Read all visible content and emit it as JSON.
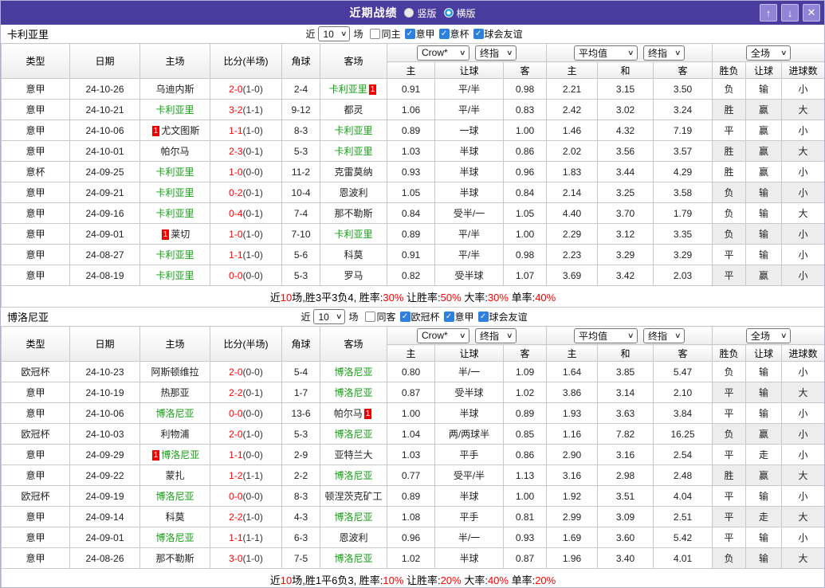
{
  "window": {
    "title": "近期战绩",
    "view_options": [
      {
        "label": "竖版",
        "selected": true
      },
      {
        "label": "横版",
        "selected": false
      }
    ]
  },
  "icons": {
    "select_arrow": "∨",
    "check": "✓",
    "up": "↑",
    "down": "↓",
    "close": "✕"
  },
  "card_label": "1",
  "columns": [
    "类型",
    "日期",
    "主场",
    "比分(半场)",
    "角球",
    "客场"
  ],
  "sub_columns": [
    "主",
    "让球",
    "客",
    "主",
    "和",
    "客",
    "胜负",
    "让球",
    "进球数"
  ],
  "selects": {
    "crow": "Crow*",
    "final": "终指",
    "avg": "平均值",
    "scope": "全场"
  },
  "sections": [
    {
      "team": "卡利亚里",
      "filter": {
        "prefix": "近",
        "count": "10",
        "suffix": "场",
        "options": [
          {
            "label": "同主",
            "checked": false
          },
          {
            "label": "意甲",
            "checked": true
          },
          {
            "label": "意杯",
            "checked": true
          },
          {
            "label": "球会友谊",
            "checked": true
          }
        ]
      },
      "rows": [
        {
          "type": "意甲",
          "tc": "sa",
          "date": "24-10-26",
          "home": "乌迪内斯",
          "hg": false,
          "hc": false,
          "score": "2-0",
          "half": "(1-0)",
          "corner": "2-4",
          "away": "卡利亚里",
          "ag": true,
          "ac": true,
          "o1": "0.91",
          "hd": "平/半",
          "o2": "0.98",
          "a1": "2.21",
          "a2": "3.15",
          "a3": "3.50",
          "r1": "负",
          "c1": "b",
          "r2": "输",
          "c2": "b",
          "r3": "小",
          "c3": "b"
        },
        {
          "type": "意甲",
          "tc": "sa",
          "date": "24-10-21",
          "home": "卡利亚里",
          "hg": true,
          "hc": false,
          "score": "3-2",
          "half": "(1-1)",
          "corner": "9-12",
          "away": "都灵",
          "ag": false,
          "ac": false,
          "o1": "1.06",
          "hd": "平/半",
          "o2": "0.83",
          "a1": "2.42",
          "a2": "3.02",
          "a3": "3.24",
          "r1": "胜",
          "c1": "r",
          "r2": "赢",
          "c2": "r",
          "r3": "大",
          "c3": "r"
        },
        {
          "type": "意甲",
          "tc": "sa",
          "date": "24-10-06",
          "home": "尤文图斯",
          "hg": false,
          "hc": true,
          "score": "1-1",
          "half": "(1-0)",
          "corner": "8-3",
          "away": "卡利亚里",
          "ag": true,
          "ac": false,
          "o1": "0.89",
          "hd": "一球",
          "o2": "1.00",
          "a1": "1.46",
          "a2": "4.32",
          "a3": "7.19",
          "r1": "平",
          "c1": "g",
          "r2": "赢",
          "c2": "r",
          "r3": "小",
          "c3": "b"
        },
        {
          "type": "意甲",
          "tc": "sa",
          "date": "24-10-01",
          "home": "帕尔马",
          "hg": false,
          "hc": false,
          "score": "2-3",
          "half": "(0-1)",
          "corner": "5-3",
          "away": "卡利亚里",
          "ag": true,
          "ac": false,
          "o1": "1.03",
          "hd": "半球",
          "o2": "0.86",
          "a1": "2.02",
          "a2": "3.56",
          "a3": "3.57",
          "r1": "胜",
          "c1": "r",
          "r2": "赢",
          "c2": "r",
          "r3": "大",
          "c3": "r"
        },
        {
          "type": "意杯",
          "tc": "ib",
          "date": "24-09-25",
          "home": "卡利亚里",
          "hg": true,
          "hc": false,
          "score": "1-0",
          "half": "(0-0)",
          "corner": "11-2",
          "away": "克雷莫纳",
          "ag": false,
          "ac": false,
          "o1": "0.93",
          "hd": "半球",
          "o2": "0.96",
          "a1": "1.83",
          "a2": "3.44",
          "a3": "4.29",
          "r1": "胜",
          "c1": "r",
          "r2": "赢",
          "c2": "r",
          "r3": "小",
          "c3": "b"
        },
        {
          "type": "意甲",
          "tc": "sa",
          "date": "24-09-21",
          "home": "卡利亚里",
          "hg": true,
          "hc": false,
          "score": "0-2",
          "half": "(0-1)",
          "corner": "10-4",
          "away": "恩波利",
          "ag": false,
          "ac": false,
          "o1": "1.05",
          "hd": "半球",
          "o2": "0.84",
          "a1": "2.14",
          "a2": "3.25",
          "a3": "3.58",
          "r1": "负",
          "c1": "b",
          "r2": "输",
          "c2": "b",
          "r3": "小",
          "c3": "b"
        },
        {
          "type": "意甲",
          "tc": "sa",
          "date": "24-09-16",
          "home": "卡利亚里",
          "hg": true,
          "hc": false,
          "score": "0-4",
          "half": "(0-1)",
          "corner": "7-4",
          "away": "那不勒斯",
          "ag": false,
          "ac": false,
          "o1": "0.84",
          "hd": "受半/一",
          "o2": "1.05",
          "a1": "4.40",
          "a2": "3.70",
          "a3": "1.79",
          "r1": "负",
          "c1": "b",
          "r2": "输",
          "c2": "b",
          "r3": "大",
          "c3": "r"
        },
        {
          "type": "意甲",
          "tc": "sa",
          "date": "24-09-01",
          "home": "莱切",
          "hg": false,
          "hc": true,
          "score": "1-0",
          "half": "(1-0)",
          "corner": "7-10",
          "away": "卡利亚里",
          "ag": true,
          "ac": false,
          "o1": "0.89",
          "hd": "平/半",
          "o2": "1.00",
          "a1": "2.29",
          "a2": "3.12",
          "a3": "3.35",
          "r1": "负",
          "c1": "b",
          "r2": "输",
          "c2": "b",
          "r3": "小",
          "c3": "b"
        },
        {
          "type": "意甲",
          "tc": "sa",
          "date": "24-08-27",
          "home": "卡利亚里",
          "hg": true,
          "hc": false,
          "score": "1-1",
          "half": "(1-0)",
          "corner": "5-6",
          "away": "科莫",
          "ag": false,
          "ac": false,
          "o1": "0.91",
          "hd": "平/半",
          "o2": "0.98",
          "a1": "2.23",
          "a2": "3.29",
          "a3": "3.29",
          "r1": "平",
          "c1": "g",
          "r2": "输",
          "c2": "b",
          "r3": "小",
          "c3": "b"
        },
        {
          "type": "意甲",
          "tc": "sa",
          "date": "24-08-19",
          "home": "卡利亚里",
          "hg": true,
          "hc": false,
          "score": "0-0",
          "half": "(0-0)",
          "corner": "5-3",
          "away": "罗马",
          "ag": false,
          "ac": false,
          "o1": "0.82",
          "hd": "受半球",
          "o2": "1.07",
          "a1": "3.69",
          "a2": "3.42",
          "a3": "2.03",
          "r1": "平",
          "c1": "g",
          "r2": "赢",
          "c2": "r",
          "r3": "小",
          "c3": "b"
        }
      ],
      "summary": [
        [
          "近",
          "k"
        ],
        [
          "10",
          "r"
        ],
        [
          "场,胜3平3负4, 胜率:",
          "k"
        ],
        [
          "30%",
          "r"
        ],
        [
          " 让胜率:",
          "k"
        ],
        [
          "50%",
          "r"
        ],
        [
          " 大率:",
          "k"
        ],
        [
          "30%",
          "r"
        ],
        [
          " 单率:",
          "k"
        ],
        [
          "40%",
          "r"
        ]
      ]
    },
    {
      "team": "博洛尼亚",
      "filter": {
        "prefix": "近",
        "count": "10",
        "suffix": "场",
        "options": [
          {
            "label": "同客",
            "checked": false
          },
          {
            "label": "欧冠杯",
            "checked": true
          },
          {
            "label": "意甲",
            "checked": true
          },
          {
            "label": "球会友谊",
            "checked": true
          }
        ]
      },
      "rows": [
        {
          "type": "欧冠杯",
          "tc": "cl",
          "date": "24-10-23",
          "home": "阿斯顿维拉",
          "hg": false,
          "hc": false,
          "score": "2-0",
          "half": "(0-0)",
          "corner": "5-4",
          "away": "博洛尼亚",
          "ag": true,
          "ac": false,
          "o1": "0.80",
          "hd": "半/一",
          "o2": "1.09",
          "a1": "1.64",
          "a2": "3.85",
          "a3": "5.47",
          "r1": "负",
          "c1": "b",
          "r2": "输",
          "c2": "b",
          "r3": "小",
          "c3": "b"
        },
        {
          "type": "意甲",
          "tc": "sa",
          "date": "24-10-19",
          "home": "热那亚",
          "hg": false,
          "hc": false,
          "score": "2-2",
          "half": "(0-1)",
          "corner": "1-7",
          "away": "博洛尼亚",
          "ag": true,
          "ac": false,
          "o1": "0.87",
          "hd": "受半球",
          "o2": "1.02",
          "a1": "3.86",
          "a2": "3.14",
          "a3": "2.10",
          "r1": "平",
          "c1": "g",
          "r2": "输",
          "c2": "b",
          "r3": "大",
          "c3": "r"
        },
        {
          "type": "意甲",
          "tc": "sa",
          "date": "24-10-06",
          "home": "博洛尼亚",
          "hg": true,
          "hc": false,
          "score": "0-0",
          "half": "(0-0)",
          "corner": "13-6",
          "away": "帕尔马",
          "ag": false,
          "ac": true,
          "o1": "1.00",
          "hd": "半球",
          "o2": "0.89",
          "a1": "1.93",
          "a2": "3.63",
          "a3": "3.84",
          "r1": "平",
          "c1": "g",
          "r2": "输",
          "c2": "b",
          "r3": "小",
          "c3": "b"
        },
        {
          "type": "欧冠杯",
          "tc": "cl",
          "date": "24-10-03",
          "home": "利物浦",
          "hg": false,
          "hc": false,
          "score": "2-0",
          "half": "(1-0)",
          "corner": "5-3",
          "away": "博洛尼亚",
          "ag": true,
          "ac": false,
          "o1": "1.04",
          "hd": "两/两球半",
          "o2": "0.85",
          "a1": "1.16",
          "a2": "7.82",
          "a3": "16.25",
          "r1": "负",
          "c1": "b",
          "r2": "赢",
          "c2": "r",
          "r3": "小",
          "c3": "b"
        },
        {
          "type": "意甲",
          "tc": "sa",
          "date": "24-09-29",
          "home": "博洛尼亚",
          "hg": true,
          "hc": true,
          "score": "1-1",
          "half": "(0-0)",
          "corner": "2-9",
          "away": "亚特兰大",
          "ag": false,
          "ac": false,
          "o1": "1.03",
          "hd": "平手",
          "o2": "0.86",
          "a1": "2.90",
          "a2": "3.16",
          "a3": "2.54",
          "r1": "平",
          "c1": "g",
          "r2": "走",
          "c2": "g",
          "r3": "小",
          "c3": "b"
        },
        {
          "type": "意甲",
          "tc": "sa",
          "date": "24-09-22",
          "home": "蒙扎",
          "hg": false,
          "hc": false,
          "score": "1-2",
          "half": "(1-1)",
          "corner": "2-2",
          "away": "博洛尼亚",
          "ag": true,
          "ac": false,
          "o1": "0.77",
          "hd": "受平/半",
          "o2": "1.13",
          "a1": "3.16",
          "a2": "2.98",
          "a3": "2.48",
          "r1": "胜",
          "c1": "r",
          "r2": "赢",
          "c2": "r",
          "r3": "大",
          "c3": "r"
        },
        {
          "type": "欧冠杯",
          "tc": "cl",
          "date": "24-09-19",
          "home": "博洛尼亚",
          "hg": true,
          "hc": false,
          "score": "0-0",
          "half": "(0-0)",
          "corner": "8-3",
          "away": "顿涅茨克矿工",
          "ag": false,
          "ac": false,
          "o1": "0.89",
          "hd": "半球",
          "o2": "1.00",
          "a1": "1.92",
          "a2": "3.51",
          "a3": "4.04",
          "r1": "平",
          "c1": "g",
          "r2": "输",
          "c2": "b",
          "r3": "小",
          "c3": "b"
        },
        {
          "type": "意甲",
          "tc": "sa",
          "date": "24-09-14",
          "home": "科莫",
          "hg": false,
          "hc": false,
          "score": "2-2",
          "half": "(1-0)",
          "corner": "4-3",
          "away": "博洛尼亚",
          "ag": true,
          "ac": false,
          "o1": "1.08",
          "hd": "平手",
          "o2": "0.81",
          "a1": "2.99",
          "a2": "3.09",
          "a3": "2.51",
          "r1": "平",
          "c1": "g",
          "r2": "走",
          "c2": "g",
          "r3": "大",
          "c3": "r"
        },
        {
          "type": "意甲",
          "tc": "sa",
          "date": "24-09-01",
          "home": "博洛尼亚",
          "hg": true,
          "hc": false,
          "score": "1-1",
          "half": "(1-1)",
          "corner": "6-3",
          "away": "恩波利",
          "ag": false,
          "ac": false,
          "o1": "0.96",
          "hd": "半/一",
          "o2": "0.93",
          "a1": "1.69",
          "a2": "3.60",
          "a3": "5.42",
          "r1": "平",
          "c1": "g",
          "r2": "输",
          "c2": "b",
          "r3": "小",
          "c3": "b"
        },
        {
          "type": "意甲",
          "tc": "sa",
          "date": "24-08-26",
          "home": "那不勒斯",
          "hg": false,
          "hc": false,
          "score": "3-0",
          "half": "(1-0)",
          "corner": "7-5",
          "away": "博洛尼亚",
          "ag": true,
          "ac": false,
          "o1": "1.02",
          "hd": "半球",
          "o2": "0.87",
          "a1": "1.96",
          "a2": "3.40",
          "a3": "4.01",
          "r1": "负",
          "c1": "b",
          "r2": "输",
          "c2": "b",
          "r3": "大",
          "c3": "r"
        }
      ],
      "summary": [
        [
          "近",
          "k"
        ],
        [
          "10",
          "r"
        ],
        [
          "场,胜1平6负3, 胜率:",
          "k"
        ],
        [
          "10%",
          "r"
        ],
        [
          " 让胜率:",
          "k"
        ],
        [
          "20%",
          "r"
        ],
        [
          " 大率:",
          "k"
        ],
        [
          "40%",
          "r"
        ],
        [
          " 单率:",
          "k"
        ],
        [
          "20%",
          "r"
        ]
      ]
    }
  ]
}
